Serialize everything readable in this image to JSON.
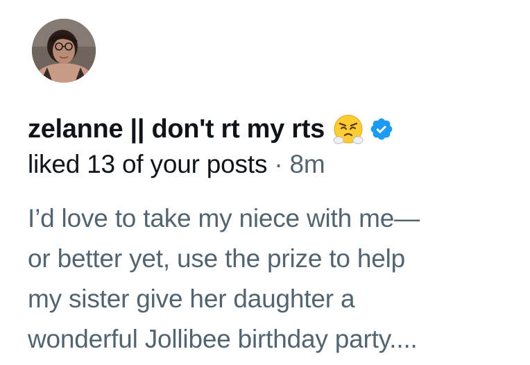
{
  "notification": {
    "avatar_icon": "user-profile-photo",
    "display_name": "zelanne || don't rt my rts",
    "name_emoji": "face-with-steam-from-nose",
    "verified_icon": "verified-badge-icon",
    "action": "liked 13 of your posts",
    "separator": "·",
    "time": "8m",
    "post_lines": [
      "I’d love to take my niece with me—",
      "or better yet, use the prize to help",
      "my sister give her daughter a",
      "wonderful Jollibee birthday party...."
    ]
  },
  "colors": {
    "name": "#0f1419",
    "secondary": "#536471",
    "verified": "#1d9bf0",
    "background": "#ffffff"
  }
}
